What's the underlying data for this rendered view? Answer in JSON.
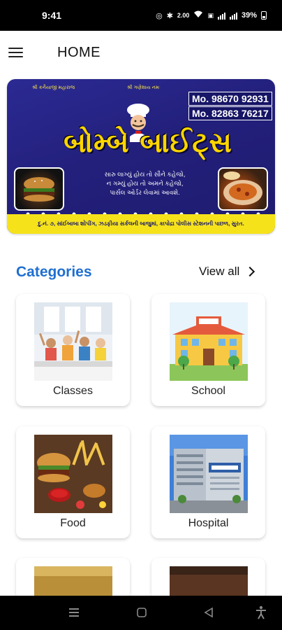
{
  "status_bar": {
    "time": "9:41",
    "network_speed": "2.00",
    "battery": "39%"
  },
  "header": {
    "title": "HOME"
  },
  "banner": {
    "top_left_text": "શ્રી કનૈયાજી મહારાજ",
    "top_mid_text": "શ્રી ગણેશાય નમઃ",
    "phone_1": "Mo. 98670 92931",
    "phone_2": "Mo. 82863 76217",
    "shop_name": "બોમ્બે બાઈટ્સ",
    "tagline": [
      "સારુ લાગ્યું હોય તો સૌને કહેજો,",
      "ન ગમ્યું હોય તો અમને કહેજો,",
      "પાર્સલ ઓર્ડર લેવામાં આવશે."
    ],
    "address": "દુ.નં. ૭, સાંઈબાબા શોપીંગ, ઝડફીયા સર્કલની બાજુમાં, કાપોદ્રા પોલીસ સ્ટેશનની પાછળ, સુરત."
  },
  "categories": {
    "title": "Categories",
    "view_all": "View all",
    "items": [
      {
        "label": "Classes"
      },
      {
        "label": "School"
      },
      {
        "label": "Food"
      },
      {
        "label": "Hospital"
      },
      {
        "label": ""
      },
      {
        "label": ""
      }
    ]
  },
  "colors": {
    "accent": "#1f6fd1",
    "banner_bg": "#2b2a93",
    "banner_text": "#ffd600"
  }
}
